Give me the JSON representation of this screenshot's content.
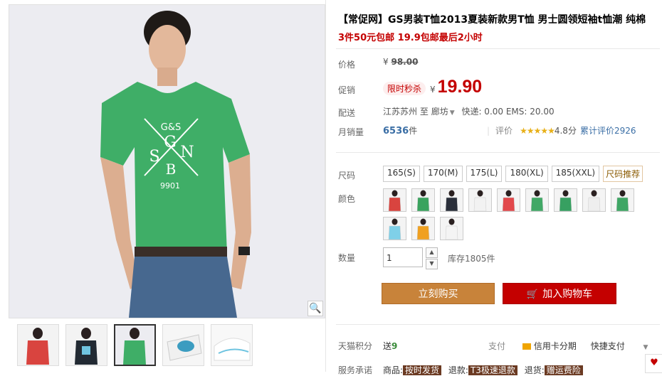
{
  "product": {
    "title": "【常促网】GS男装T恤2013夏装新款男T恤 男士圆领短袖t恤潮 纯棉",
    "subtitle": "3件50元包邮 19.9包邮最后2小时"
  },
  "price": {
    "label": "价格",
    "currency": "¥",
    "original": "98.00",
    "promo_label": "促销",
    "promo_tag": "限时秒杀",
    "promo_price": "19.90"
  },
  "shipping": {
    "label": "配送",
    "from": "江苏苏州",
    "to_word": "至",
    "to": "廊坊",
    "express": "快递: 0.00 EMS: 20.00"
  },
  "sales": {
    "label": "月销量",
    "count": "6536",
    "unit": "件",
    "review_label": "评价",
    "stars": "★★★★★",
    "score": "4.8分",
    "total_reviews": "累计评价2926"
  },
  "size": {
    "label": "尺码",
    "options": [
      "165(S)",
      "170(M)",
      "175(L)",
      "180(XL)",
      "185(XXL)"
    ],
    "recommend": "尺码推荐"
  },
  "color": {
    "label": "颜色",
    "swatches": [
      "#d9443f",
      "#3aa35e",
      "#2a2f3a",
      "#f2f2f2",
      "#e2494c",
      "#41a866",
      "#37a061",
      "#eeeeee",
      "#3fa665",
      "#7fd0e8",
      "#f0a020",
      "#f4f4f4"
    ]
  },
  "quantity": {
    "label": "数量",
    "value": "1",
    "stock": "库存1805件"
  },
  "actions": {
    "buy_now": "立刻购买",
    "add_cart": "加入购物车"
  },
  "points": {
    "label": "天猫积分",
    "prefix": "送",
    "value": "9",
    "pay_label": "支付",
    "credit": "信用卡分期",
    "fast_pay": "快捷支付"
  },
  "service": {
    "label": "服务承诺",
    "goods": "商品:",
    "goods_tag": "按时发货",
    "refund": "退款:",
    "refund_tag": "T3极速退款",
    "return": "退货:",
    "return_tag": "赠运费险"
  },
  "colors": {
    "accent_red": "#c40000",
    "buy_orange": "#c8833a",
    "shirt_green": "#3fae67"
  }
}
